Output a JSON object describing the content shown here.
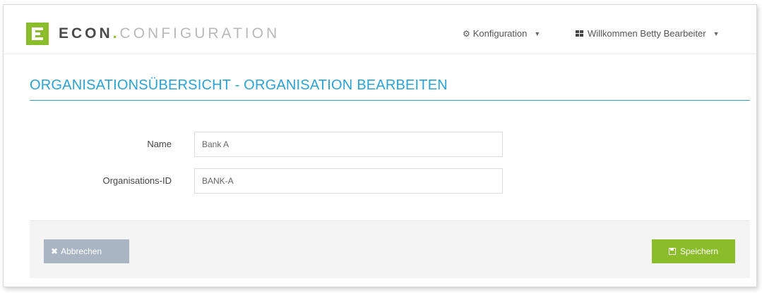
{
  "brand": {
    "logo_letter": "E",
    "name_primary": "ECON",
    "separator": ".",
    "name_secondary": "CONFIGURATION",
    "accent_color": "#8bbd2a"
  },
  "nav": {
    "config_icon": "gear-icon",
    "config_label": "Konfiguration",
    "user_icon": "grid-icon",
    "user_label": "Willkommen Betty Bearbeiter"
  },
  "page": {
    "title": "ORGANISATIONSÜBERSICHT - ORGANISATION BEARBEITEN",
    "title_color": "#29a3d8"
  },
  "form": {
    "name_label": "Name",
    "name_value": "Bank A",
    "orgid_label": "Organisations-ID",
    "orgid_value": "BANK-A"
  },
  "actions": {
    "cancel_icon": "close-icon",
    "cancel_label": "Abbrechen",
    "save_icon": "floppy-disk-icon",
    "save_label": "Speichern"
  }
}
